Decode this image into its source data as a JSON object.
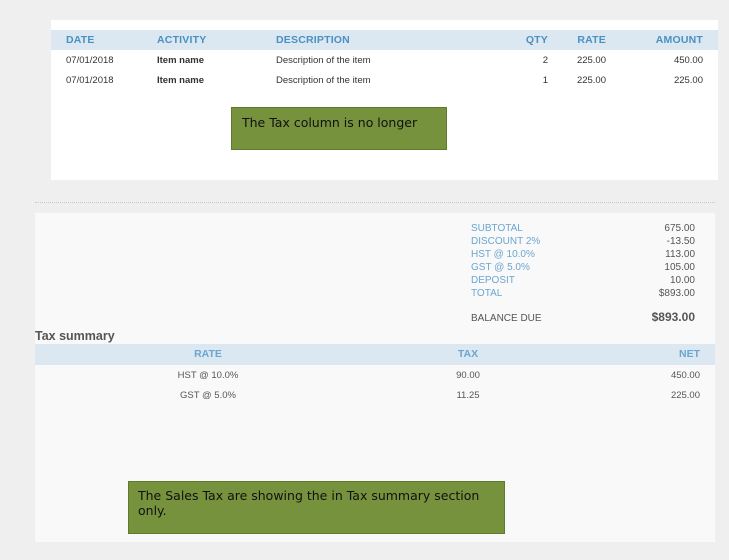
{
  "items_table": {
    "headers": {
      "date": "DATE",
      "activity": "ACTIVITY",
      "description": "DESCRIPTION",
      "qty": "QTY",
      "rate": "RATE",
      "amount": "AMOUNT"
    },
    "rows": [
      {
        "date": "07/01/2018",
        "activity": "Item name",
        "description": "Description of the item",
        "qty": "2",
        "rate": "225.00",
        "amount": "450.00"
      },
      {
        "date": "07/01/2018",
        "activity": "Item name",
        "description": "Description of the item",
        "qty": "1",
        "rate": "225.00",
        "amount": "225.00"
      }
    ]
  },
  "annotations": {
    "note_top": "The Tax column is no longer",
    "note_bottom": "The Sales Tax are showing the in Tax summary section only.",
    "color": "#76923c"
  },
  "totals": {
    "lines": [
      {
        "label": "SUBTOTAL",
        "value": "675.00"
      },
      {
        "label": "DISCOUNT 2%",
        "value": "-13.50"
      },
      {
        "label": "HST @ 10.0%",
        "value": "113.00"
      },
      {
        "label": "GST @ 5.0%",
        "value": "105.00"
      },
      {
        "label": "DEPOSIT",
        "value": "10.00"
      },
      {
        "label": "TOTAL",
        "value": "$893.00"
      }
    ],
    "balance_label": "BALANCE DUE",
    "balance_value": "$893.00"
  },
  "tax_summary": {
    "title": "Tax summary",
    "headers": {
      "rate": "RATE",
      "tax": "TAX",
      "net": "NET"
    },
    "rows": [
      {
        "rate": "HST @ 10.0%",
        "tax": "90.00",
        "net": "450.00"
      },
      {
        "rate": "GST @ 5.0%",
        "tax": "11.25",
        "net": "225.00"
      }
    ]
  },
  "colors": {
    "header_bg": "#dbe7f1",
    "header_text": "#4a90c2",
    "page_bg": "#efefef"
  }
}
